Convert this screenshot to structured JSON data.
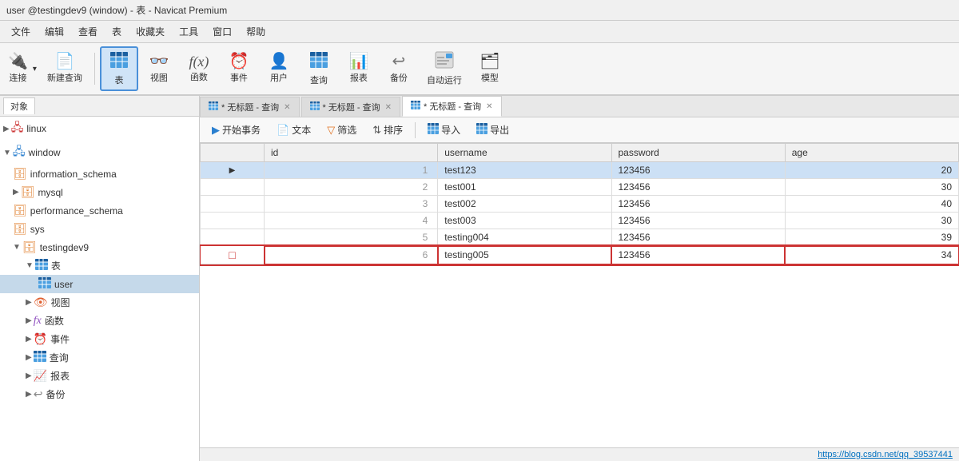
{
  "titleBar": {
    "text": "user @testingdev9 (window) - 表 - Navicat Premium"
  },
  "menuBar": {
    "items": [
      "文件",
      "编辑",
      "查看",
      "表",
      "收藏夹",
      "工具",
      "窗口",
      "帮助"
    ]
  },
  "toolbar": {
    "groups": [
      {
        "items": [
          {
            "id": "connect",
            "label": "连接",
            "icon": "🔌",
            "hasArrow": true
          },
          {
            "id": "new-query",
            "label": "新建查询",
            "icon": "📄",
            "active": false
          }
        ]
      },
      {
        "items": [
          {
            "id": "table",
            "label": "表",
            "icon": "📊",
            "active": true
          },
          {
            "id": "view",
            "label": "视图",
            "icon": "👓",
            "active": false
          },
          {
            "id": "function",
            "label": "函数",
            "icon": "ƒ(x)",
            "active": false
          },
          {
            "id": "event",
            "label": "事件",
            "icon": "⏰",
            "active": false
          },
          {
            "id": "user",
            "label": "用户",
            "icon": "👤",
            "active": false
          },
          {
            "id": "query",
            "label": "查询",
            "icon": "📋",
            "active": false
          },
          {
            "id": "report",
            "label": "报表",
            "icon": "📊",
            "active": false
          },
          {
            "id": "backup",
            "label": "备份",
            "icon": "⏮",
            "active": false
          },
          {
            "id": "autorun",
            "label": "自动运行",
            "icon": "⏱",
            "active": false
          },
          {
            "id": "model",
            "label": "模型",
            "icon": "🗂",
            "active": false
          }
        ]
      }
    ]
  },
  "sidebar": {
    "items": [
      {
        "id": "linux",
        "label": "linux",
        "type": "server",
        "indent": 0,
        "expanded": false,
        "selected": false
      },
      {
        "id": "window",
        "label": "window",
        "type": "server",
        "indent": 0,
        "expanded": true,
        "selected": false
      },
      {
        "id": "information_schema",
        "label": "information_schema",
        "type": "db",
        "indent": 1,
        "expanded": false,
        "selected": false
      },
      {
        "id": "mysql",
        "label": "mysql",
        "type": "db",
        "indent": 1,
        "expanded": false,
        "selected": false
      },
      {
        "id": "performance_schema",
        "label": "performance_schema",
        "type": "db",
        "indent": 1,
        "expanded": false,
        "selected": false
      },
      {
        "id": "sys",
        "label": "sys",
        "type": "db",
        "indent": 1,
        "expanded": false,
        "selected": false
      },
      {
        "id": "testingdev9",
        "label": "testingdev9",
        "type": "db",
        "indent": 1,
        "expanded": true,
        "selected": false
      },
      {
        "id": "tables-group",
        "label": "表",
        "type": "table-group",
        "indent": 2,
        "expanded": true,
        "selected": false
      },
      {
        "id": "user-table",
        "label": "user",
        "type": "table",
        "indent": 3,
        "expanded": false,
        "selected": true
      },
      {
        "id": "views-group",
        "label": "视图",
        "type": "view-group",
        "indent": 2,
        "expanded": false,
        "selected": false
      },
      {
        "id": "funcs-group",
        "label": "函数",
        "type": "func-group",
        "indent": 2,
        "expanded": false,
        "selected": false
      },
      {
        "id": "events-group",
        "label": "事件",
        "type": "event-group",
        "indent": 2,
        "expanded": false,
        "selected": false
      },
      {
        "id": "queries-group",
        "label": "查询",
        "type": "query-group",
        "indent": 2,
        "expanded": false,
        "selected": false
      },
      {
        "id": "reports-group",
        "label": "报表",
        "type": "report-group",
        "indent": 2,
        "expanded": false,
        "selected": false
      },
      {
        "id": "backups-group",
        "label": "备份",
        "type": "backup-group",
        "indent": 2,
        "expanded": false,
        "selected": false
      }
    ]
  },
  "sidebarTab": {
    "label": "对象"
  },
  "tabs": [
    {
      "id": "tab1",
      "label": "* 无标题 - 查询",
      "active": false
    },
    {
      "id": "tab2",
      "label": "* 无标题 - 查询",
      "active": false
    },
    {
      "id": "tab3",
      "label": "* 无标题 - 查询",
      "active": true
    }
  ],
  "tableToolbar": {
    "buttons": [
      {
        "id": "begin-transaction",
        "label": "开始事务",
        "icon": "▶"
      },
      {
        "id": "text",
        "label": "文本",
        "icon": "📄"
      },
      {
        "id": "filter",
        "label": "筛选",
        "icon": "🔽"
      },
      {
        "id": "sort",
        "label": "排序",
        "icon": "↕"
      },
      {
        "id": "import",
        "label": "导入",
        "icon": "📥"
      },
      {
        "id": "export",
        "label": "导出",
        "icon": "📤"
      }
    ]
  },
  "tableData": {
    "columns": [
      "id",
      "username",
      "password",
      "age"
    ],
    "rows": [
      {
        "indicator": "▶",
        "indicatorType": "arrow",
        "id": "1",
        "username": "test123",
        "password": "123456",
        "age": "20"
      },
      {
        "indicator": "",
        "indicatorType": "none",
        "id": "2",
        "username": "test001",
        "password": "123456",
        "age": "30"
      },
      {
        "indicator": "",
        "indicatorType": "none",
        "id": "3",
        "username": "test002",
        "password": "123456",
        "age": "40"
      },
      {
        "indicator": "",
        "indicatorType": "none",
        "id": "4",
        "username": "test003",
        "password": "123456",
        "age": "30"
      },
      {
        "indicator": "",
        "indicatorType": "none",
        "id": "5",
        "username": "testing004",
        "password": "123456",
        "age": "39"
      },
      {
        "indicator": "□",
        "indicatorType": "edit",
        "id": "6",
        "username": "testing005",
        "password": "123456",
        "age": "34"
      }
    ]
  },
  "statusBar": {
    "text": "https://blog.csdn.net/qq_39537441"
  }
}
